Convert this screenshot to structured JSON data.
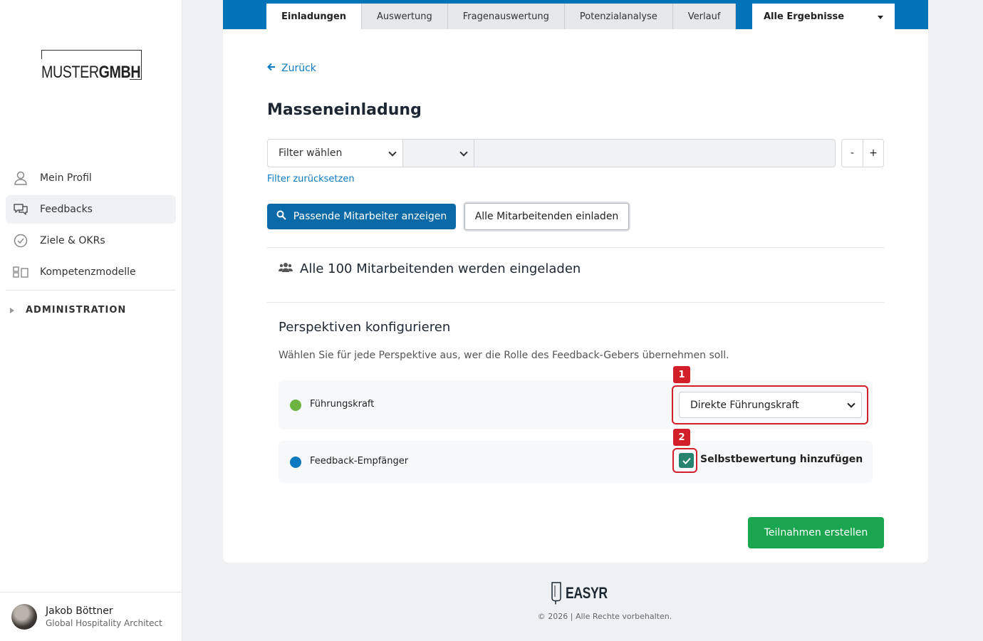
{
  "brand": {
    "logo_light": "MUSTER",
    "logo_bold": "GMBH",
    "footer_logo": "EASYR"
  },
  "sidebar": {
    "items": [
      {
        "label": "Mein Profil",
        "icon": "user-icon"
      },
      {
        "label": "Feedbacks",
        "icon": "chat-icon",
        "active": true
      },
      {
        "label": "Ziele & OKRs",
        "icon": "check-circle-icon"
      },
      {
        "label": "Kompetenzmodelle",
        "icon": "model-icon"
      }
    ],
    "admin_label": "ADMINISTRATION"
  },
  "user": {
    "name": "Jakob Böttner",
    "role": "Global Hospitality Architect"
  },
  "tabs": [
    {
      "label": "Einladungen",
      "active": true
    },
    {
      "label": "Auswertung"
    },
    {
      "label": "Fragenauswertung"
    },
    {
      "label": "Potenzialanalyse"
    },
    {
      "label": "Verlauf"
    }
  ],
  "results_select": {
    "value": "Alle Ergebnisse"
  },
  "main": {
    "back_label": "Zurück",
    "title": "Masseneinladung",
    "filter": {
      "select1_value": "Filter wählen",
      "select2_value": "",
      "text_value": "",
      "minus_label": "-",
      "plus_label": "+",
      "reset_label": "Filter zurücksetzen"
    },
    "buttons": {
      "show_matching": "Passende Mitarbeiter anzeigen",
      "invite_all": "Alle Mitarbeitenden einladen",
      "create": "Teilnahmen erstellen"
    },
    "info_text": "Alle 100 Mitarbeitenden werden eingeladen",
    "perspectives": {
      "title": "Perspektiven konfigurieren",
      "description": "Wählen Sie für jede Perspektive aus, wer die Rolle des Feedback-Gebers übernehmen soll.",
      "rows": [
        {
          "label": "Führungskraft",
          "color": "#6cb33f",
          "select_value": "Direkte Führungskraft"
        },
        {
          "label": "Feedback-Empfänger",
          "color": "#0a79bf",
          "checkbox_label": "Selbstbewertung hinzufügen",
          "checked": true
        }
      ]
    },
    "callouts": [
      "1",
      "2"
    ]
  },
  "footer": {
    "copyright": "© 2026 | Alle Rechte vorbehalten."
  },
  "colors": {
    "accent": "#0073b9",
    "primary_button": "#0a6aa8",
    "success": "#1aa64f",
    "callout": "#d21f2a",
    "checkbox": "#26836d"
  }
}
